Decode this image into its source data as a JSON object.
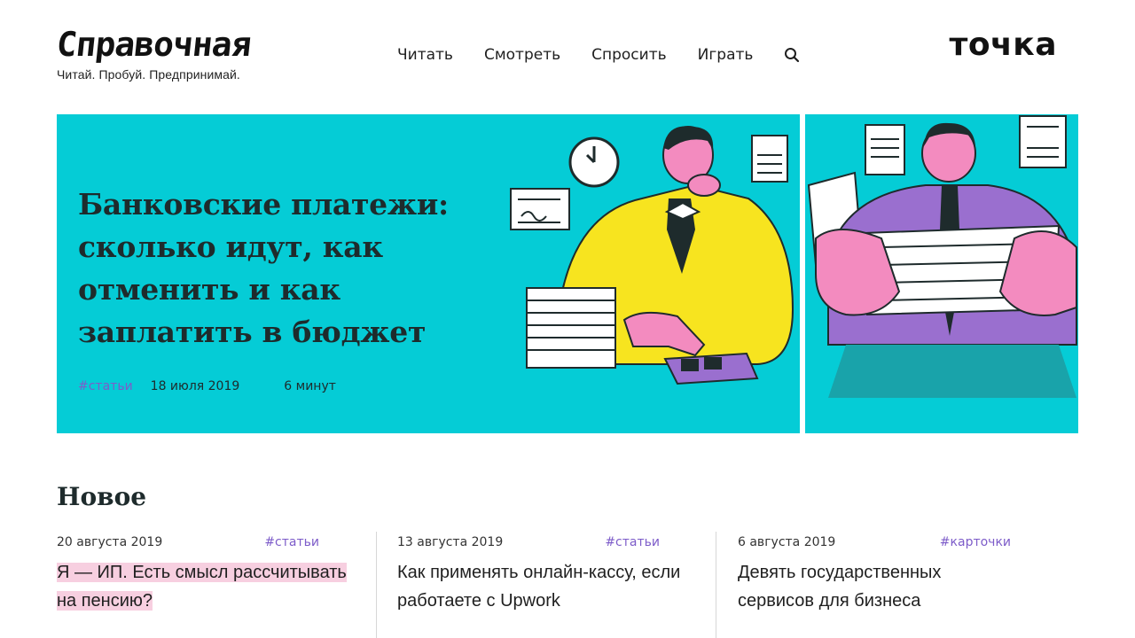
{
  "header": {
    "logo": "Справочная",
    "tagline": "Читай. Пробуй. Предпринимай.",
    "nav": [
      "Читать",
      "Смотреть",
      "Спросить",
      "Играть"
    ],
    "brand": "точка"
  },
  "hero": {
    "title": "Банковские платежи: сколько идут, как отменить и как заплатить в бюджет",
    "tag": "#статьи",
    "date": "18 июля 2019",
    "read_time": "6 минут",
    "background": "#05ccd6"
  },
  "section": {
    "title": "Новое"
  },
  "cards": [
    {
      "date": "20 августа 2019",
      "tag": "#статьи",
      "title": "Я — ИП. Есть смысл рассчитывать на пенсию?"
    },
    {
      "date": "13 августа 2019",
      "tag": "#статьи",
      "title": "Как применять онлайн-кассу, если работаете с Upwork"
    },
    {
      "date": "6 августа 2019",
      "tag": "#карточки",
      "title": "Девять государственных сервисов для бизнеса"
    }
  ],
  "colors": {
    "accent_tag": "#7d5cc9",
    "highlight": "#f7cfe0",
    "hero_bg": "#05ccd6"
  },
  "icons": {
    "search": "search-icon"
  }
}
